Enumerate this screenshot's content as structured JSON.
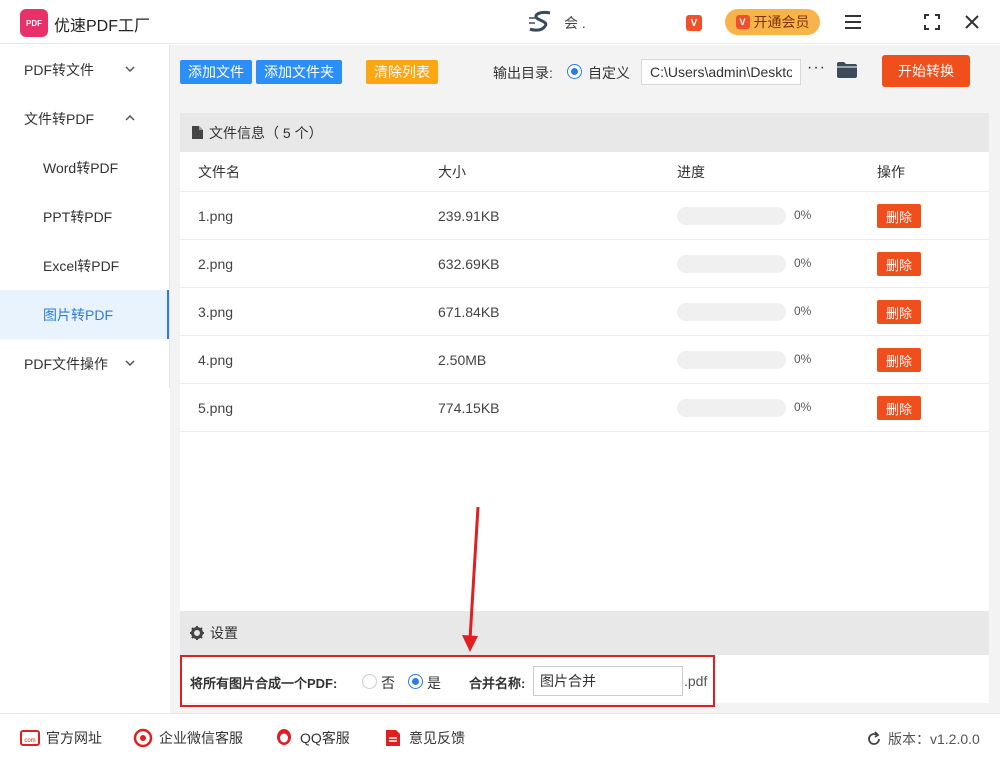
{
  "app": {
    "title": "优速PDF工厂",
    "logo_text": "PDF",
    "user_name": "会 .",
    "vip_label": "开通会员"
  },
  "sidebar": {
    "items": [
      {
        "label": "PDF转文件",
        "chevron": "⌄"
      },
      {
        "label": "文件转PDF",
        "chevron": "⌃"
      },
      {
        "label": "Word转PDF"
      },
      {
        "label": "PPT转PDF"
      },
      {
        "label": "Excel转PDF"
      },
      {
        "label": "图片转PDF"
      },
      {
        "label": "PDF文件操作",
        "chevron": "⌄"
      }
    ]
  },
  "toolbar": {
    "add_file": "添加文件",
    "add_folder": "添加文件夹",
    "clear_list": "清除列表",
    "output_label": "输出目录:",
    "output_option": "自定义",
    "output_path": "C:\\Users\\admin\\Desktop",
    "more": "···",
    "start": "开始转换"
  },
  "file_panel": {
    "header": "文件信息（ 5 个）",
    "columns": [
      "文件名",
      "大小",
      "进度",
      "操作"
    ],
    "rows": [
      {
        "name": "1.png",
        "size": "239.91KB",
        "progress": "0%",
        "action": "删除"
      },
      {
        "name": "2.png",
        "size": "632.69KB",
        "progress": "0%",
        "action": "删除"
      },
      {
        "name": "3.png",
        "size": "671.84KB",
        "progress": "0%",
        "action": "删除"
      },
      {
        "name": "4.png",
        "size": "2.50MB",
        "progress": "0%",
        "action": "删除"
      },
      {
        "name": "5.png",
        "size": "774.15KB",
        "progress": "0%",
        "action": "删除"
      }
    ]
  },
  "settings": {
    "header": "设置",
    "merge_label": "将所有图片合成一个PDF:",
    "option_no": "否",
    "option_yes": "是",
    "selected": "是",
    "name_label": "合并名称:",
    "name_value": "图片合并",
    "suffix": ".pdf"
  },
  "footer": {
    "website": "官方网址",
    "wechat": "企业微信客服",
    "qq": "QQ客服",
    "feedback": "意见反馈",
    "version": "版本：v1.2.0.0"
  },
  "colors": {
    "accent": "#2c8ef8",
    "danger": "#f04f1c",
    "warning": "#fba613",
    "vip": "#f8b34a",
    "highlight": "#e02020"
  }
}
